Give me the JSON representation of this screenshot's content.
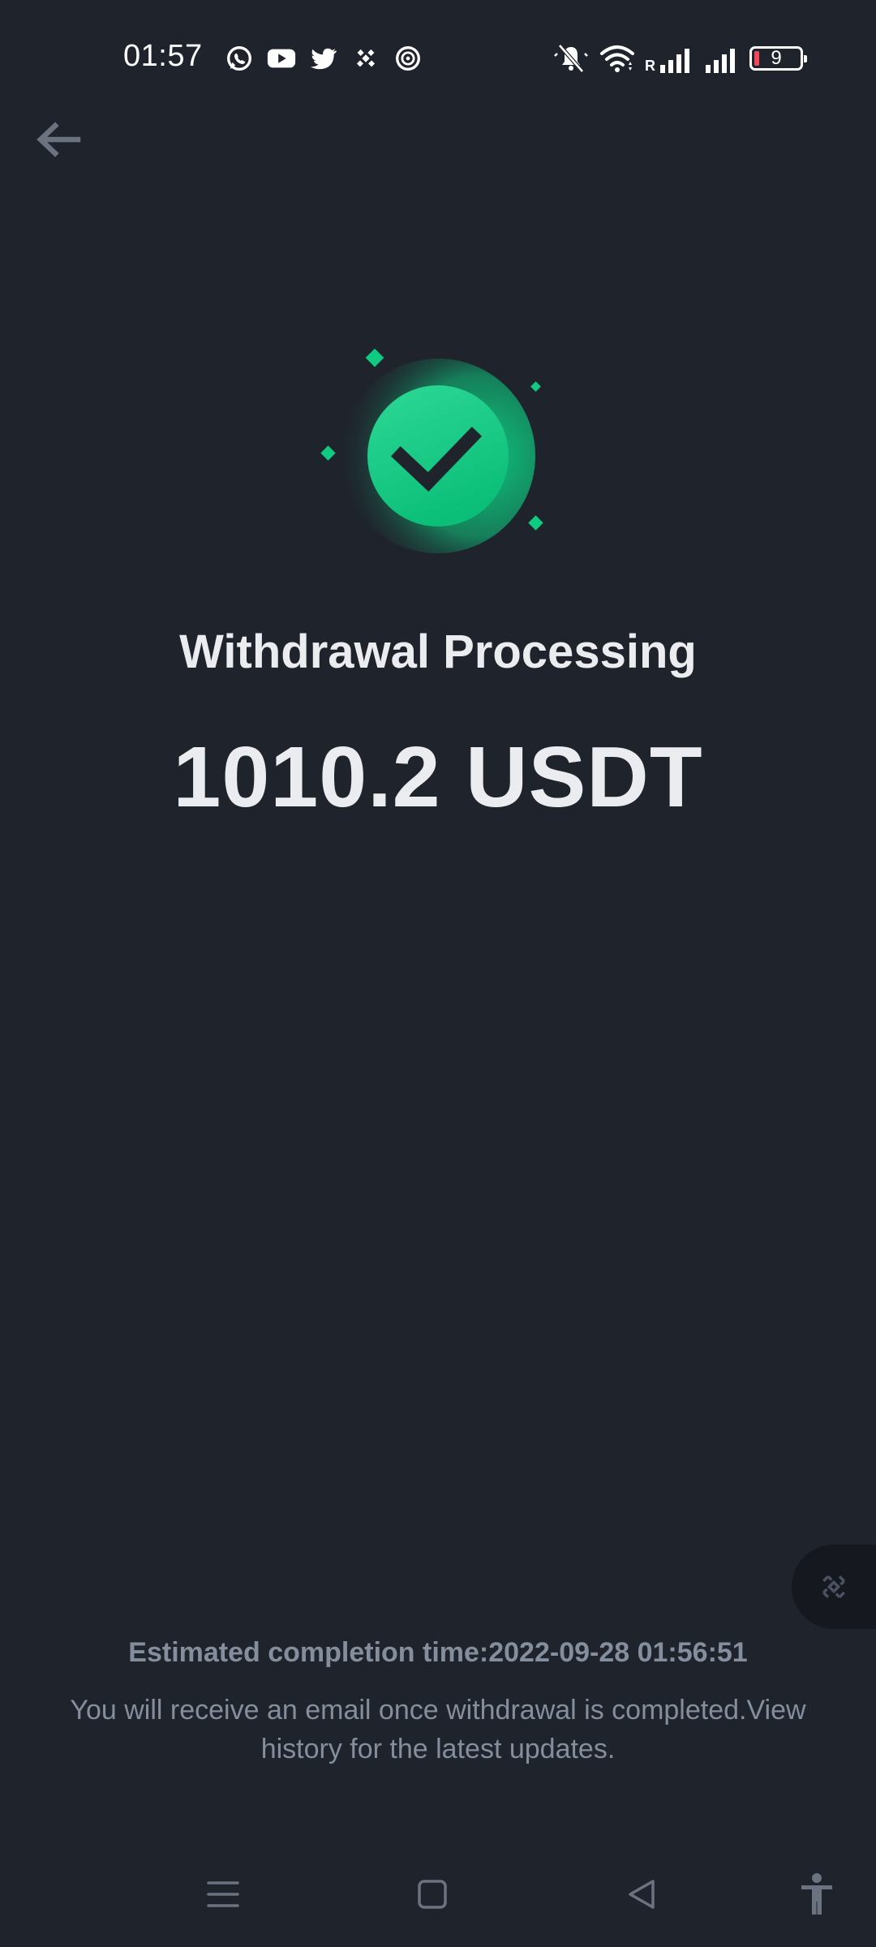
{
  "status_bar": {
    "time": "01:57",
    "notification_icons": [
      "whatsapp-icon",
      "youtube-icon",
      "twitter-icon",
      "binance-icon",
      "target-app-icon"
    ],
    "system_icons": [
      "mute-icon",
      "wifi-icon",
      "signal-roaming-icon",
      "signal-icon",
      "battery-icon"
    ],
    "roaming_label": "R",
    "battery_level": "9",
    "battery_low_color": "#f6465d"
  },
  "header": {
    "back_icon": "back-arrow-icon"
  },
  "result": {
    "icon": "check-circle-icon",
    "accent_color": "#0ecb81",
    "title": "Withdrawal Processing",
    "amount": "1010.2 USDT"
  },
  "floating_widget": {
    "icon": "binance-logo-icon"
  },
  "footer": {
    "estimate": "Estimated completion time:2022-09-28 01:56:51",
    "note": "You will receive an email once withdrawal is completed.View history for the latest updates."
  },
  "nav_bar": {
    "icons": [
      "menu-icon",
      "home-icon",
      "back-icon",
      "accessibility-icon"
    ]
  },
  "theme": {
    "background": "#1f232c",
    "text_primary": "#eaecef",
    "text_secondary": "#848e9c"
  }
}
